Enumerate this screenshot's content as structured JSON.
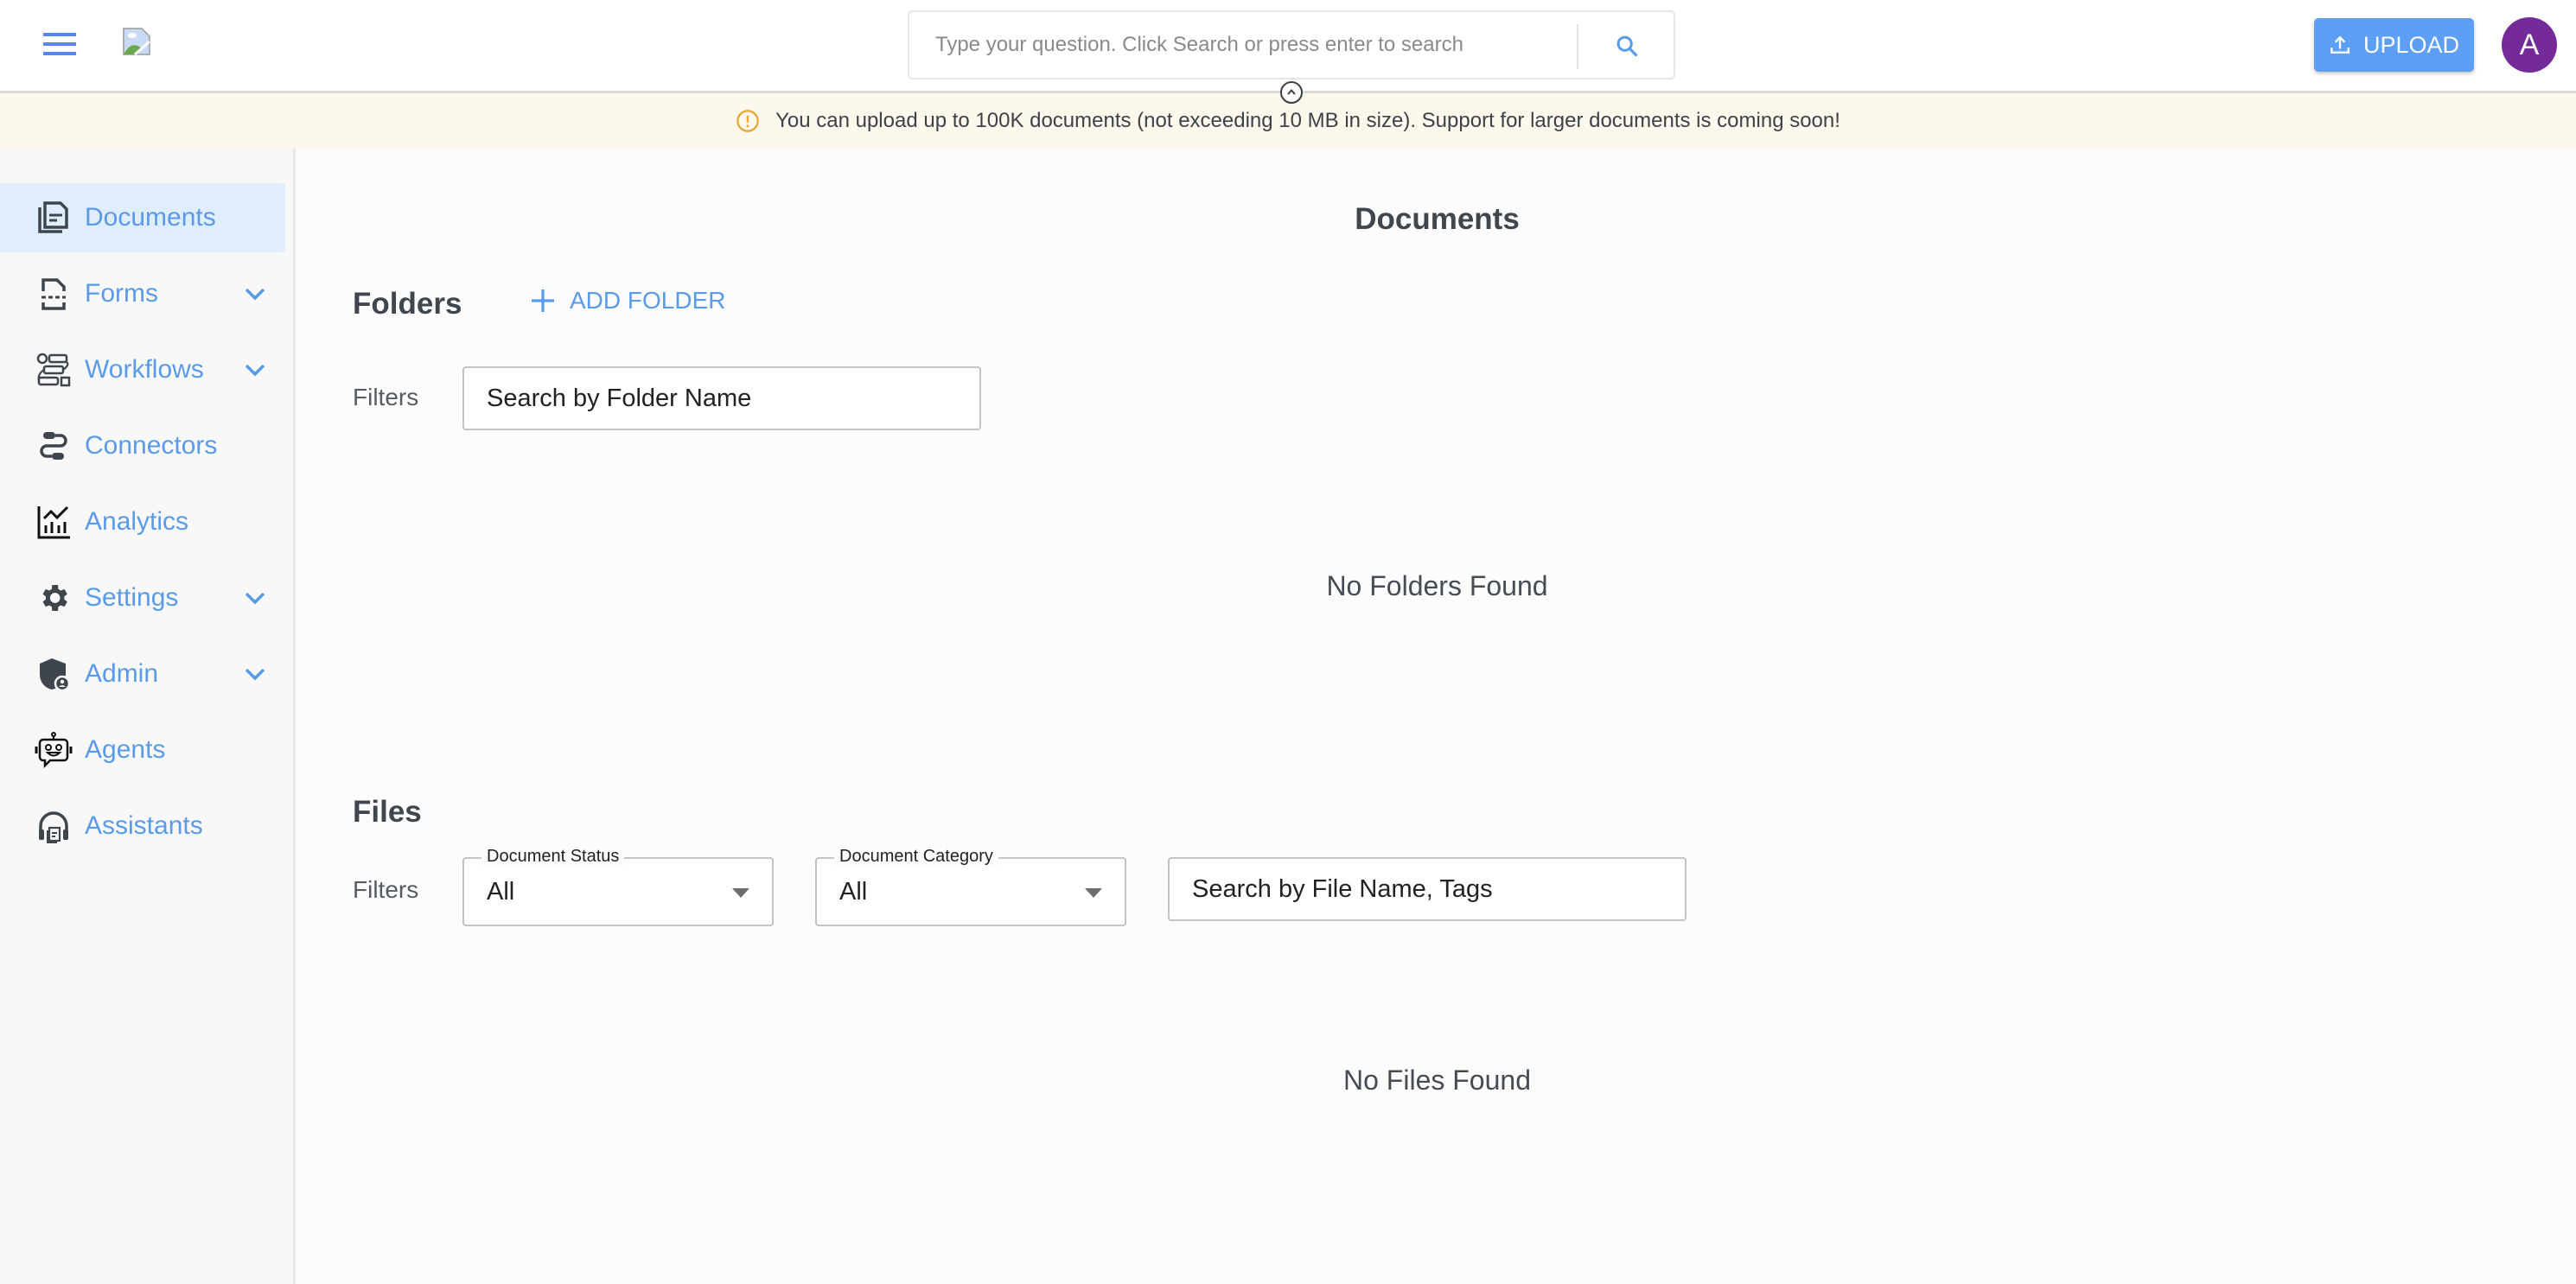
{
  "header": {
    "search_placeholder": "Type your question. Click Search or press enter to search",
    "upload_label": "UPLOAD",
    "avatar_initial": "A",
    "accent_color": "#5c9ff5",
    "avatar_color": "#742a99"
  },
  "banner": {
    "message": "You can upload up to 100K documents (not exceeding 10 MB in size). Support for larger documents is coming soon!",
    "icon": "warning-circle-icon"
  },
  "sidebar": {
    "items": [
      {
        "label": "Documents",
        "icon": "documents-icon",
        "expandable": false,
        "active": true
      },
      {
        "label": "Forms",
        "icon": "forms-icon",
        "expandable": true,
        "active": false
      },
      {
        "label": "Workflows",
        "icon": "workflows-icon",
        "expandable": true,
        "active": false
      },
      {
        "label": "Connectors",
        "icon": "connectors-icon",
        "expandable": false,
        "active": false
      },
      {
        "label": "Analytics",
        "icon": "analytics-icon",
        "expandable": false,
        "active": false
      },
      {
        "label": "Settings",
        "icon": "gear-icon",
        "expandable": true,
        "active": false
      },
      {
        "label": "Admin",
        "icon": "admin-shield-icon",
        "expandable": true,
        "active": false
      },
      {
        "label": "Agents",
        "icon": "robot-icon",
        "expandable": false,
        "active": false
      },
      {
        "label": "Assistants",
        "icon": "headset-icon",
        "expandable": false,
        "active": false
      }
    ]
  },
  "main": {
    "title": "Documents",
    "folders": {
      "title": "Folders",
      "add_label": "ADD FOLDER",
      "filters_label": "Filters",
      "search_placeholder": "Search by Folder Name",
      "empty_message": "No Folders Found"
    },
    "files": {
      "title": "Files",
      "filters_label": "Filters",
      "status_filter": {
        "label": "Document Status",
        "value": "All"
      },
      "category_filter": {
        "label": "Document Category",
        "value": "All"
      },
      "search_placeholder": "Search by File Name, Tags",
      "empty_message": "No Files Found"
    }
  }
}
